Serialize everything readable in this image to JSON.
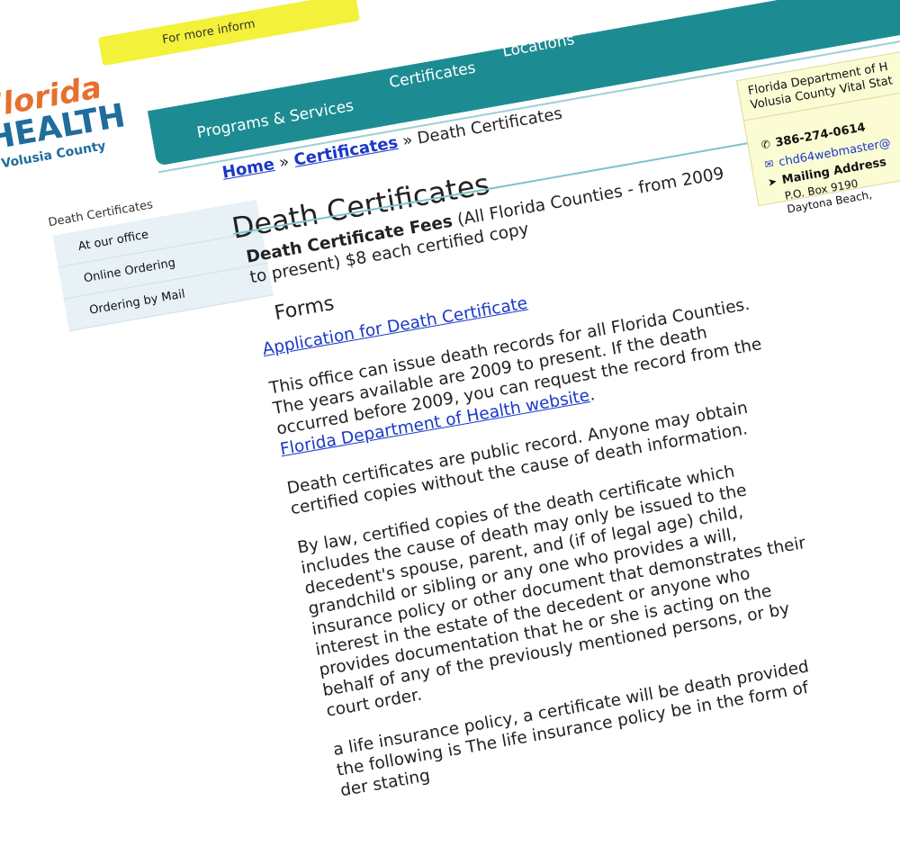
{
  "topbar": {
    "text": "For more inform"
  },
  "logo": {
    "florida": "Florida",
    "health": "HEALTH",
    "county": "Volusia County"
  },
  "nav": {
    "items": [
      "Locations",
      "Certificates",
      "Programs & Services"
    ]
  },
  "breadcrumb": {
    "home": "Home",
    "sep1": " » ",
    "certificates": "Certificates",
    "sep2": " » ",
    "current": "Death Certificates"
  },
  "page": {
    "title": "Death Certificates"
  },
  "sidebar": {
    "title": "Death Certificates",
    "items": [
      "At our office",
      "Online Ordering",
      "Ordering by Mail"
    ]
  },
  "content": {
    "fees_label": "Death Certificate Fees",
    "fees_text": " (All Florida Counties - from 2009 to present) $8 each certified copy",
    "forms_heading": "Forms",
    "form_link": "Application for Death Certificate",
    "p1_text": "This office can issue death records for all Florida Counties. The years available are 2009 to present. If the death occurred before 2009, you can request the record from the ",
    "p1_link": "Florida Department of Health website",
    "p1_end": ".",
    "p2": "Death certificates are public record. Anyone may obtain certified copies without the cause of death information.",
    "p3": "By law, certified copies of the death certificate which includes the cause of death may only be issued to the decedent's spouse, parent, and (if of legal age) child, grandchild or sibling or any one who provides a will, insurance policy or other document that demonstrates their interest in the estate of the decedent or anyone who provides documentation that he or she is acting on the behalf of any of the previously mentioned persons, or by court order.",
    "p4": "a life insurance policy, a certificate will be death provided the following is The life insurance policy be in the form of der stating"
  },
  "contact": {
    "title_line1": "Florida Department of H",
    "title_line2": "Volusia County Vital Stat",
    "phone": "386-274-0614",
    "email": "chd64webmaster@",
    "mailing_label": "Mailing Address",
    "address_line1": "P.O. Box 9190",
    "address_line2": "Daytona Beach,"
  }
}
